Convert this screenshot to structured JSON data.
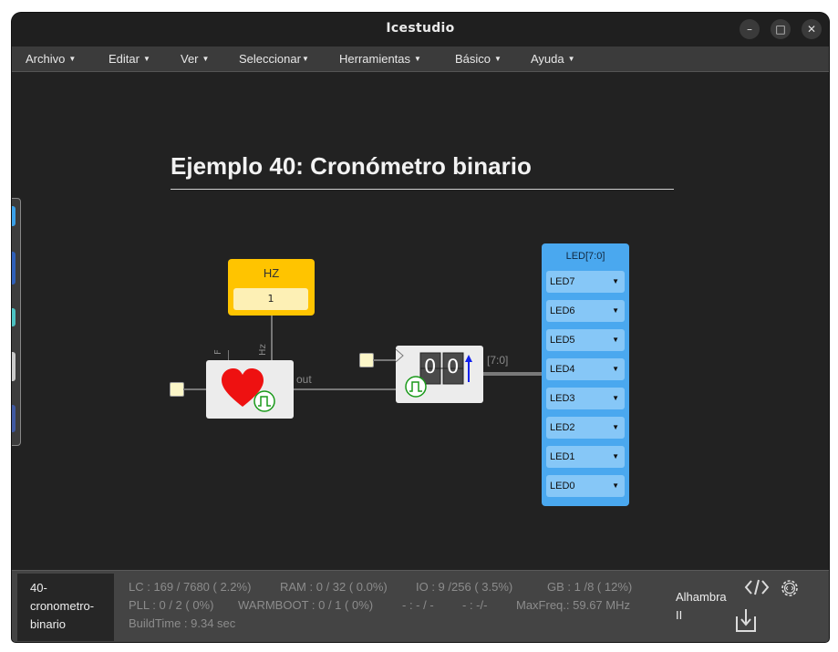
{
  "window": {
    "title": "Icestudio",
    "controls": {
      "minimize": "–",
      "maximize": "□",
      "close": "✕"
    }
  },
  "menu": [
    {
      "label": "Archivo"
    },
    {
      "label": "Editar"
    },
    {
      "label": "Ver"
    },
    {
      "label": "Seleccionar"
    },
    {
      "label": "Herramientas"
    },
    {
      "label": "Básico"
    },
    {
      "label": "Ayuda"
    }
  ],
  "canvas": {
    "heading": "Ejemplo 40: Cronómetro binario",
    "constant": {
      "label": "HZ",
      "value": "1"
    },
    "heart_block": {
      "port_f": "F",
      "port_hz": "Hz",
      "out_label": "out"
    },
    "counter_block": {
      "digits": [
        "0",
        "0"
      ]
    },
    "bus_label": "[7:0]",
    "led_block": {
      "label": "LED[7:0]",
      "rows": [
        "LED7",
        "LED6",
        "LED5",
        "LED4",
        "LED3",
        "LED2",
        "LED1",
        "LED0"
      ]
    }
  },
  "statusbar": {
    "project_name": "40-cronometro-binario",
    "lines": [
      [
        "LC : 169 / 7680 ( 2.2%)",
        "RAM : 0 / 32 ( 0.0%)",
        "IO : 9 /256 ( 3.5%)",
        "GB : 1 /8 ( 12%)"
      ],
      [
        "PLL : 0 / 2 ( 0%)",
        "WARMBOOT : 0 / 1 ( 0%)",
        "- : - / -",
        "- : -/-",
        "MaxFreq.: 59.67 MHz"
      ],
      [
        "BuildTime : 9.34 sec"
      ]
    ],
    "board": "Alhambra II"
  },
  "colors": {
    "constant": "#ffc400",
    "led_block": "#4aa8ef",
    "heart": "#ee1111",
    "clock_icon": "#1a9a1a",
    "counter_arrow": "#1020ee"
  },
  "icons": [
    "heart-icon",
    "clock-pulse-icon",
    "up-arrow-icon",
    "code-icon",
    "settings-gear-icon",
    "download-icon"
  ]
}
